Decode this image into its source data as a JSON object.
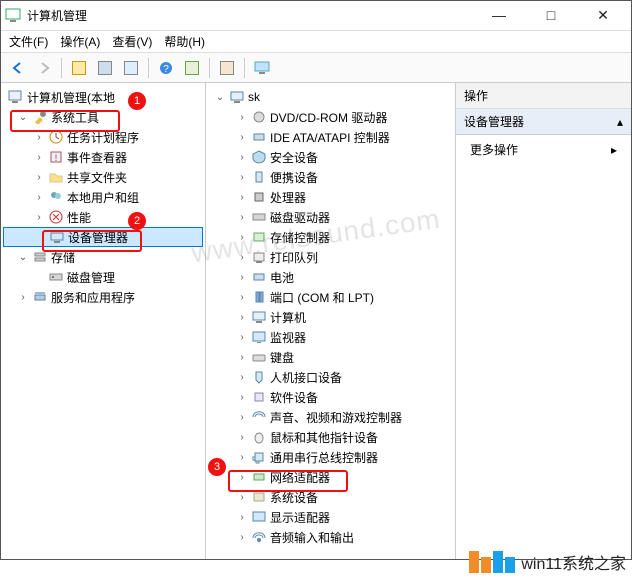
{
  "title": "计算机管理",
  "menubar": {
    "file": "文件(F)",
    "action": "操作(A)",
    "view": "查看(V)",
    "help": "帮助(H)"
  },
  "left_tree": {
    "root": "计算机管理(本地",
    "system_tools": "系统工具",
    "children": [
      "任务计划程序",
      "事件查看器",
      "共享文件夹",
      "本地用户和组",
      "性能",
      "设备管理器"
    ],
    "storage": "存储",
    "disk_mgmt": "磁盘管理",
    "services": "服务和应用程序"
  },
  "mid_tree": {
    "root": "sk",
    "items": [
      "DVD/CD-ROM 驱动器",
      "IDE ATA/ATAPI 控制器",
      "安全设备",
      "便携设备",
      "处理器",
      "磁盘驱动器",
      "存储控制器",
      "打印队列",
      "电池",
      "端口 (COM 和 LPT)",
      "计算机",
      "监视器",
      "键盘",
      "人机接口设备",
      "软件设备",
      "声音、视频和游戏控制器",
      "鼠标和其他指针设备",
      "通用串行总线控制器",
      "网络适配器",
      "系统设备",
      "显示适配器",
      "音频输入和输出"
    ]
  },
  "actions": {
    "header": "操作",
    "category": "设备管理器",
    "more": "更多操作"
  },
  "callouts": {
    "1": "1",
    "2": "2",
    "3": "3"
  },
  "watermark": "www.relsound.com",
  "footer": "win11系统之家"
}
